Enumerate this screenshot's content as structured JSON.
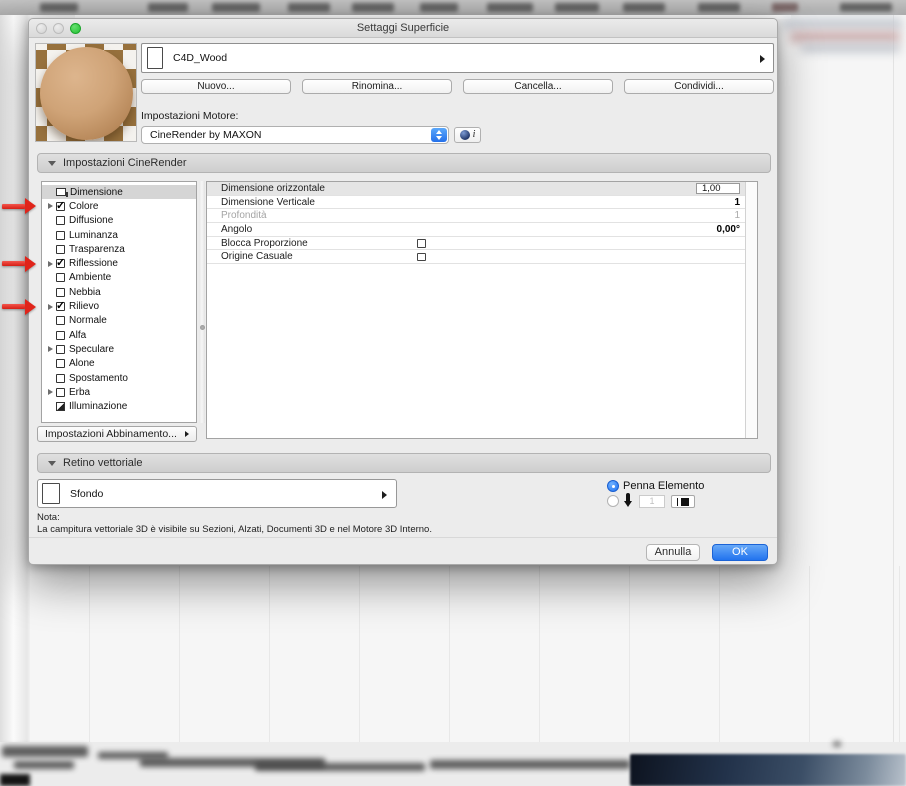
{
  "window": {
    "title": "Settaggi Superficie"
  },
  "material": {
    "name": "C4D_Wood"
  },
  "actions": {
    "new": "Nuovo...",
    "rename": "Rinomina...",
    "delete": "Cancella...",
    "share": "Condividi..."
  },
  "engine": {
    "label": "Impostazioni Motore:",
    "value": "CineRender by MAXON",
    "info": "i"
  },
  "sections": {
    "cinerender": "Impostazioni CineRender",
    "retino": "Retino vettoriale"
  },
  "channels": [
    {
      "label": "Dimensione",
      "icon": "size",
      "selected": true,
      "expandable": false,
      "checked": false,
      "annotated": false
    },
    {
      "label": "Colore",
      "icon": "checkbox",
      "selected": false,
      "expandable": true,
      "checked": true,
      "annotated": true
    },
    {
      "label": "Diffusione",
      "icon": "checkbox",
      "selected": false,
      "expandable": false,
      "checked": false,
      "annotated": false
    },
    {
      "label": "Luminanza",
      "icon": "checkbox",
      "selected": false,
      "expandable": false,
      "checked": false,
      "annotated": false
    },
    {
      "label": "Trasparenza",
      "icon": "checkbox",
      "selected": false,
      "expandable": false,
      "checked": false,
      "annotated": false
    },
    {
      "label": "Riflessione",
      "icon": "checkbox",
      "selected": false,
      "expandable": true,
      "checked": true,
      "annotated": true
    },
    {
      "label": "Ambiente",
      "icon": "checkbox",
      "selected": false,
      "expandable": false,
      "checked": false,
      "annotated": false
    },
    {
      "label": "Nebbia",
      "icon": "checkbox",
      "selected": false,
      "expandable": false,
      "checked": false,
      "annotated": false
    },
    {
      "label": "Rilievo",
      "icon": "checkbox",
      "selected": false,
      "expandable": true,
      "checked": true,
      "annotated": true
    },
    {
      "label": "Normale",
      "icon": "checkbox",
      "selected": false,
      "expandable": false,
      "checked": false,
      "annotated": false
    },
    {
      "label": "Alfa",
      "icon": "checkbox",
      "selected": false,
      "expandable": false,
      "checked": false,
      "annotated": false
    },
    {
      "label": "Speculare",
      "icon": "checkbox",
      "selected": false,
      "expandable": true,
      "checked": false,
      "annotated": false
    },
    {
      "label": "Alone",
      "icon": "checkbox",
      "selected": false,
      "expandable": false,
      "checked": false,
      "annotated": false
    },
    {
      "label": "Spostamento",
      "icon": "checkbox",
      "selected": false,
      "expandable": false,
      "checked": false,
      "annotated": false
    },
    {
      "label": "Erba",
      "icon": "checkbox",
      "selected": false,
      "expandable": true,
      "checked": false,
      "annotated": false
    },
    {
      "label": "Illuminazione",
      "icon": "illumination",
      "selected": false,
      "expandable": false,
      "checked": false,
      "annotated": false
    }
  ],
  "params": [
    {
      "label": "Dimensione orizzontale",
      "control": "field",
      "value": "1,00",
      "state": "selected"
    },
    {
      "label": "Dimensione Verticale",
      "control": "text",
      "value": "1",
      "state": "normal"
    },
    {
      "label": "Profondità",
      "control": "text",
      "value": "1",
      "state": "disabled"
    },
    {
      "label": "Angolo",
      "control": "text",
      "value": "0,00°",
      "state": "normal"
    },
    {
      "label": "Blocca Proporzione",
      "control": "checkbox",
      "checked": false,
      "state": "normal"
    },
    {
      "label": "Origine Casuale",
      "control": "checkbox",
      "checked": false,
      "state": "normal"
    }
  ],
  "matching": {
    "label": "Impostazioni Abbinamento..."
  },
  "retino": {
    "background_label": "Sfondo"
  },
  "pen": {
    "element_label": "Penna Elemento",
    "element_selected": true,
    "pen_value": "1"
  },
  "note": {
    "title": "Nota:",
    "text": "La campitura vettoriale 3D è visibile su Sezioni, Alzati, Documenti 3D e nel Motore 3D Interno."
  },
  "footer": {
    "cancel": "Annulla",
    "ok": "OK"
  },
  "colors": {
    "accent": "#2273ee",
    "annotation_arrow": "#e0241a",
    "ok_button": "#2273ee",
    "navy_block": "#22324a"
  }
}
